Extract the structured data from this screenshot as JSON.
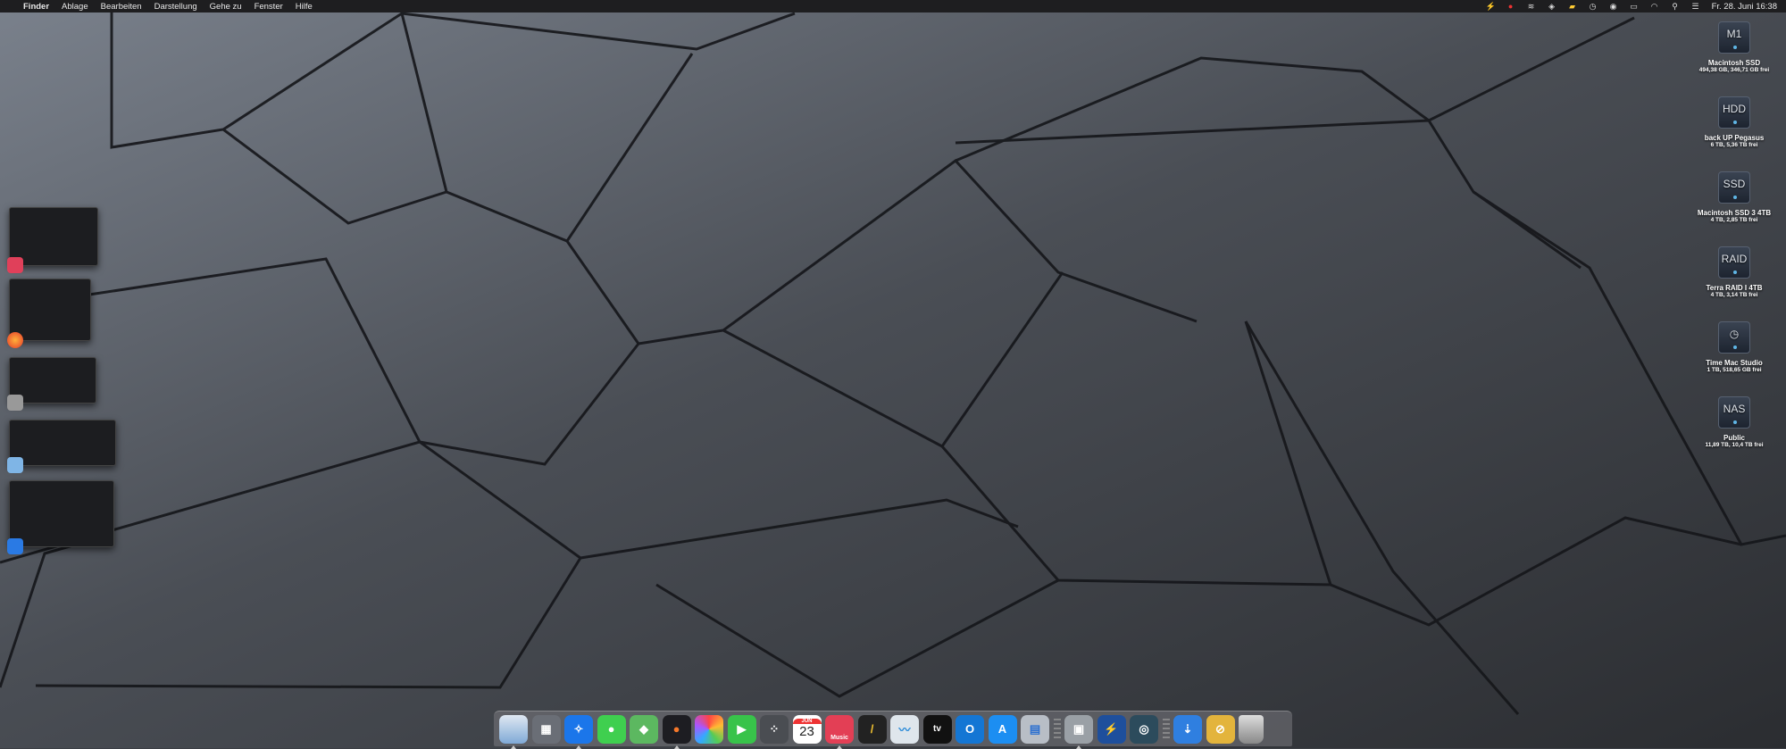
{
  "menubar": {
    "apple": "",
    "items": [
      "Finder",
      "Ablage",
      "Bearbeiten",
      "Darstellung",
      "Gehe zu",
      "Fenster",
      "Hilfe"
    ],
    "status_icons": [
      "bolt-icon",
      "cloud-record-icon",
      "broadcast-icon",
      "diamond-icon",
      "flag-icon",
      "time-machine-icon",
      "user-icon",
      "card-icon",
      "wifi-icon",
      "search-icon",
      "control-center-icon"
    ],
    "clock": "Fr. 28. Juni 16:38"
  },
  "drives": [
    {
      "name": "Macintosh SSD",
      "info": "494,38 GB, 346,71 GB frei",
      "label": "M1"
    },
    {
      "name": "back UP Pegasus",
      "info": "6 TB, 5,36 TB frei",
      "label": "HDD"
    },
    {
      "name": "Macintosh SSD 3 4TB",
      "info": "4 TB, 2,85 TB frei",
      "label": "SSD"
    },
    {
      "name": "Terra RAID I 4TB",
      "info": "4 TB, 3,14 TB frei",
      "label": "RAID"
    },
    {
      "name": "Time Mac Studio",
      "info": "1 TB, 518,65 GB frei",
      "label": "◷"
    },
    {
      "name": "Public",
      "info": "11,89 TB, 10,4 TB frei",
      "label": "NAS"
    }
  ],
  "dock": {
    "calendar_month": "JUN",
    "calendar_day": "23",
    "music_label": "Music",
    "tv_label": "tv",
    "items": [
      "finder",
      "launchpad",
      "safari",
      "messages",
      "maps",
      "firefox",
      "photos",
      "facetime",
      "system-tool",
      "calendar",
      "music",
      "writer",
      "grapher",
      "apple-tv",
      "outlook",
      "app-store",
      "mission-control",
      "preview",
      "reeder",
      "camera",
      "downloads",
      "documents",
      "trash"
    ]
  },
  "colors": {
    "menubar": "#1e1e20",
    "wallpaper": "#3c3f45"
  }
}
